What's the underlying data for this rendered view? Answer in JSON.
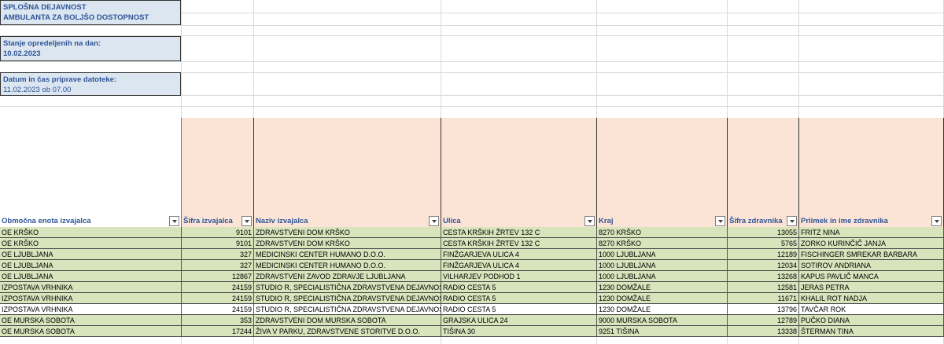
{
  "info_boxes": {
    "box1": {
      "line1": "SPLOŠNA DEJAVNOST",
      "line2": "AMBULANTA ZA BOLJŠO DOSTOPNOST"
    },
    "box2": {
      "label": "Stanje opredeljenih na dan:",
      "value": "10.02.2023"
    },
    "box3": {
      "label": "Datum in čas priprave datoteke:",
      "value": "11.02.2023 ob 07.00"
    }
  },
  "columns": [
    "Območna enota izvajalca",
    "Šifra izvajalca",
    "Naziv izvajalca",
    "Ulica",
    "Kraj",
    "Šifra zdravnika",
    "Priimek in ime zdravnika"
  ],
  "rows": [
    [
      "OE KRŠKO",
      "9101",
      "ZDRAVSTVENI DOM KRŠKO",
      "CESTA KRŠKIH ŽRTEV 132 C",
      "8270 KRŠKO",
      "13055",
      "FRITZ NINA"
    ],
    [
      "OE KRŠKO",
      "9101",
      "ZDRAVSTVENI DOM KRŠKO",
      "CESTA KRŠKIH ŽRTEV 132 C",
      "8270 KRŠKO",
      "5765",
      "ZORKO KURINČIČ JANJA"
    ],
    [
      "OE LJUBLJANA",
      "327",
      "MEDICINSKI CENTER HUMANO D.O.O.",
      "FINŽGARJEVA ULICA 4",
      "1000 LJUBLJANA",
      "12189",
      "FISCHINGER SMREKAR BARBARA"
    ],
    [
      "OE LJUBLJANA",
      "327",
      "MEDICINSKI CENTER HUMANO D.O.O.",
      "FINŽGARJEVA ULICA 4",
      "1000 LJUBLJANA",
      "12034",
      "SOTIROV ANDRIANA"
    ],
    [
      "OE LJUBLJANA",
      "12867",
      "ZDRAVSTVENI ZAVOD ZDRAVJE LJUBLJANA",
      "VILHARJEV PODHOD 1",
      "1000 LJUBLJANA",
      "13268",
      "KAPUS PAVLIČ MANCA"
    ],
    [
      "IZPOSTAVA VRHNIKA",
      "24159",
      "STUDIO R, SPECIALISTIČNA ZDRAVSTVENA DEJAVNOST SP",
      "RADIO CESTA 5",
      "1230 DOMŽALE",
      "12581",
      "JERAS PETRA"
    ],
    [
      "IZPOSTAVA VRHNIKA",
      "24159",
      "STUDIO R, SPECIALISTIČNA ZDRAVSTVENA DEJAVNOST SP",
      "RADIO CESTA 5",
      "1230 DOMŽALE",
      "11671",
      "KHALIL ROT NADJA"
    ],
    [
      "IZPOSTAVA VRHNIKA",
      "24159",
      "STUDIO R, SPECIALISTIČNA ZDRAVSTVENA DEJAVNOST SP",
      "RADIO CESTA 5",
      "1230 DOMŽALE",
      "13796",
      "TAVČAR ROK"
    ],
    [
      "OE MURSKA SOBOTA",
      "353",
      "ZDRAVSTVENI DOM MURSKA SOBOTA",
      "GRAJSKA ULICA 24",
      "9000 MURSKA SOBOTA",
      "12789",
      "PUČKO DIANA"
    ],
    [
      "OE MURSKA SOBOTA",
      "17244",
      "ŽIVA V PARKU, ZDRAVSTVENE STORITVE D.O.O.",
      "TIŠINA 30",
      "9251 TIŠINA",
      "13338",
      "ŠTERMAN TINA"
    ]
  ],
  "row_fills": [
    "green",
    "green",
    "green",
    "green",
    "green",
    "green",
    "green",
    "white",
    "green",
    "green"
  ]
}
